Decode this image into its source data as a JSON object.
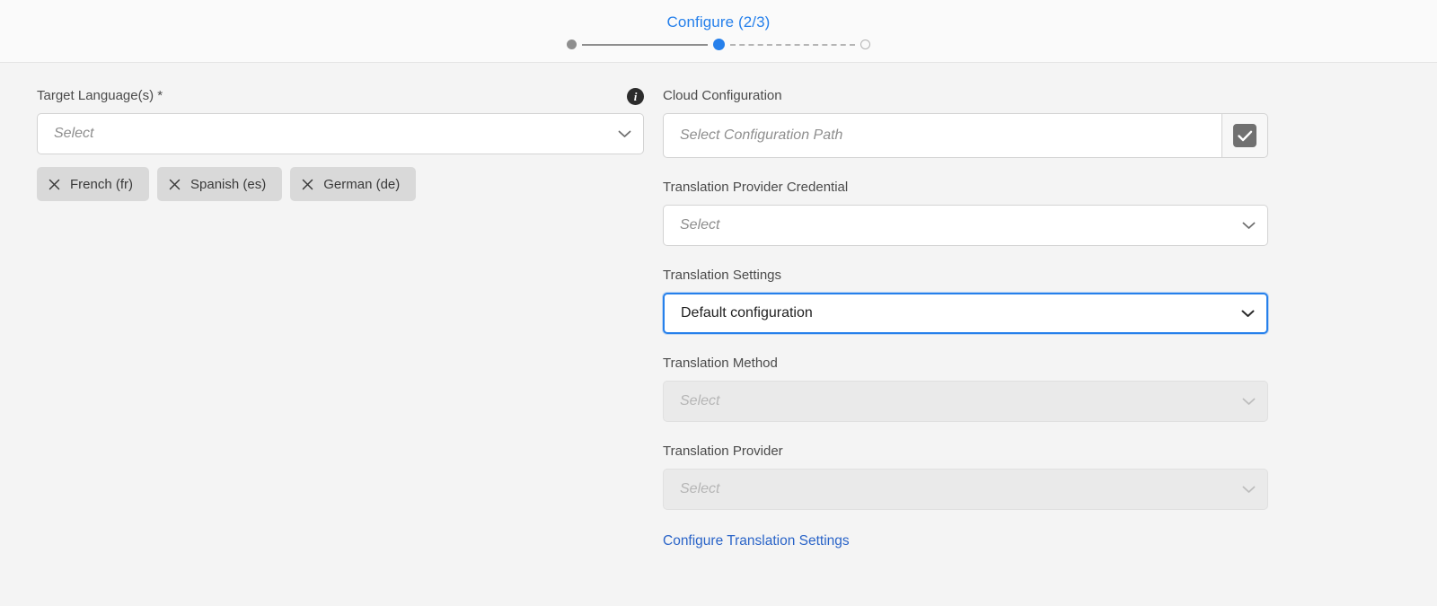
{
  "header": {
    "title": "Configure (2/3)",
    "steps": [
      {
        "name": "step-1",
        "state": "done"
      },
      {
        "name": "step-2",
        "state": "current"
      },
      {
        "name": "step-3",
        "state": "upcoming"
      }
    ],
    "accent_color": "#2680eb"
  },
  "left": {
    "target_languages": {
      "label": "Target Language(s) *",
      "info_icon": "info-icon",
      "placeholder": "Select",
      "value": "",
      "chevron_icon": "chevron-down-icon"
    },
    "selected_languages": [
      {
        "label": "French (fr)",
        "remove_icon": "close-icon"
      },
      {
        "label": "Spanish (es)",
        "remove_icon": "close-icon"
      },
      {
        "label": "German (de)",
        "remove_icon": "close-icon"
      }
    ]
  },
  "right": {
    "cloud_configuration": {
      "label": "Cloud Configuration",
      "placeholder": "Select Configuration Path",
      "value": "",
      "browse_icon": "checkbox-checked-icon"
    },
    "translation_provider_credential": {
      "label": "Translation Provider Credential",
      "placeholder": "Select",
      "value": "",
      "chevron_icon": "chevron-down-icon"
    },
    "translation_settings": {
      "label": "Translation Settings",
      "placeholder": "Select",
      "value": "Default configuration",
      "chevron_icon": "chevron-down-icon",
      "focused": true
    },
    "translation_method": {
      "label": "Translation Method",
      "placeholder": "Select",
      "value": "",
      "chevron_icon": "chevron-down-icon",
      "disabled": true
    },
    "translation_provider": {
      "label": "Translation Provider",
      "placeholder": "Select",
      "value": "",
      "chevron_icon": "chevron-down-icon",
      "disabled": true
    },
    "configure_link": "Configure Translation Settings"
  }
}
